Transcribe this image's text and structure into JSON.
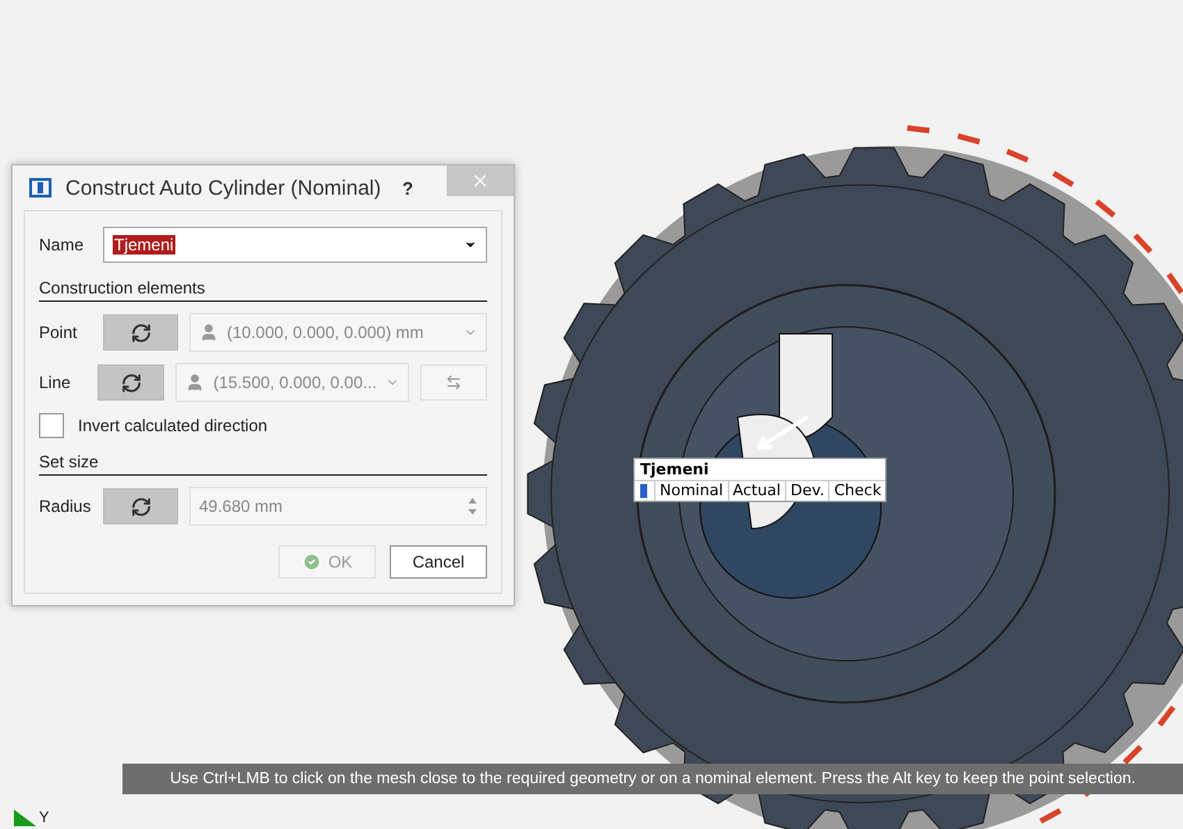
{
  "dialog": {
    "title": "Construct Auto Cylinder (Nominal)",
    "help": "?",
    "name_field": {
      "label": "Name",
      "value": "Tjemeni"
    },
    "sections": [
      {
        "heading": "Construction elements",
        "rows": [
          {
            "kind": "select",
            "label": "Point",
            "value": "(10.000, 0.000, 0.000) mm",
            "swap": false
          },
          {
            "kind": "select",
            "label": "Line",
            "value": "(15.500, 0.000, 0.00...",
            "swap": true
          }
        ],
        "checkbox": {
          "label": "Invert calculated direction",
          "checked": false
        }
      },
      {
        "heading": "Set size",
        "rows": [
          {
            "kind": "spin",
            "label": "Radius",
            "value": "49.680 mm",
            "swap": false
          }
        ]
      }
    ],
    "buttons": [
      {
        "label": "OK",
        "disabled": true
      },
      {
        "label": "Cancel",
        "disabled": false
      }
    ]
  },
  "label_tag": {
    "title": "Tjemeni",
    "columns": [
      "Nominal",
      "Actual",
      "Dev.",
      "Check"
    ]
  },
  "hint": "Use Ctrl+LMB to click on the mesh close to the required geometry or on a nominal element. Press the Alt key to keep the point selection.",
  "axis": {
    "label": "Y"
  }
}
